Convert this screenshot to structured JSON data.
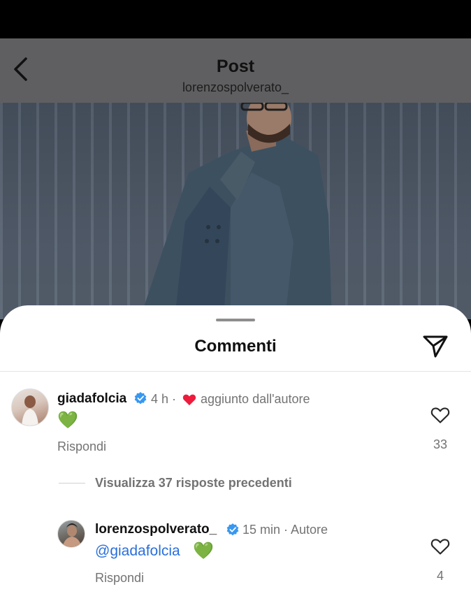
{
  "header": {
    "title": "Post",
    "subtitle": "lorenzospolverato_"
  },
  "sheet": {
    "title": "Commenti"
  },
  "comments": [
    {
      "username": "giadafolcia",
      "time": "4 h ·",
      "liked_by_author_label": "aggiunto dall'autore",
      "text": "💚",
      "reply_label": "Rispondi",
      "likes": "33"
    }
  ],
  "view_replies_label": "Visualizza 37 risposte precedenti",
  "replies": [
    {
      "username": "lorenzospolverato_",
      "meta": "15 min · Autore",
      "mention": "@giadafolcia",
      "text": "💚",
      "reply_label": "Rispondi",
      "likes": "4"
    }
  ],
  "colors": {
    "verified": "#3897f0",
    "mention": "#2a6fdb",
    "heart_red": "#ed1c3c",
    "green_heart": "#3bbf3b"
  }
}
